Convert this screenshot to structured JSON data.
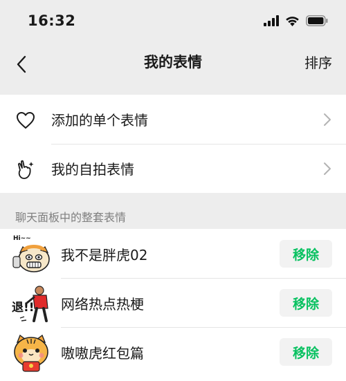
{
  "status_bar": {
    "time": "16:32"
  },
  "nav": {
    "title": "我的表情",
    "action": "排序"
  },
  "menu": [
    {
      "label": "添加的单个表情",
      "icon": "heart-icon"
    },
    {
      "label": "我的自拍表情",
      "icon": "selfie-hand-icon"
    }
  ],
  "section": {
    "title": "聊天面板中的整套表情"
  },
  "packs": [
    {
      "name": "我不是胖虎02",
      "button": "移除",
      "thumb": "tiger-hi-sticker-icon",
      "thumb_text": "Hi~~"
    },
    {
      "name": "网络热点热梗",
      "button": "移除",
      "thumb": "meme-figure-sticker-icon",
      "thumb_text": "退!!"
    },
    {
      "name": "嗷嗷虎红包篇",
      "button": "移除",
      "thumb": "tiger-red-packet-sticker-icon"
    }
  ],
  "colors": {
    "accent": "#07c160",
    "background": "#ededed",
    "button_bg": "#f2f2f2"
  }
}
